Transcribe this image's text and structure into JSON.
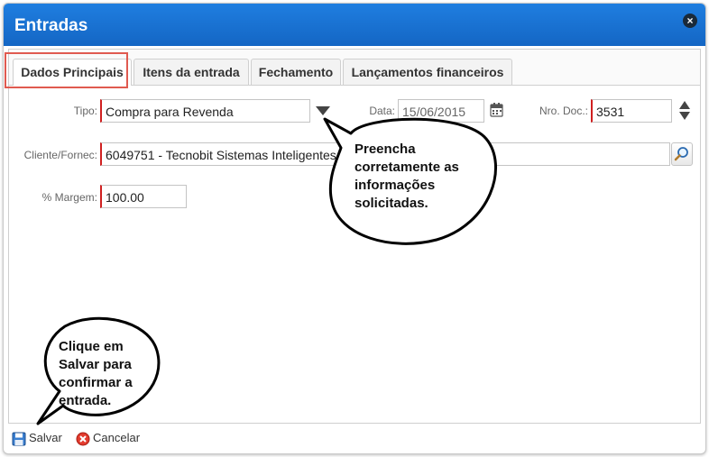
{
  "window": {
    "title": "Entradas",
    "close_glyph": "×"
  },
  "tabs": [
    {
      "label": "Dados Principais",
      "active": true
    },
    {
      "label": "Itens da entrada",
      "active": false
    },
    {
      "label": "Fechamento",
      "active": false
    },
    {
      "label": "Lançamentos financeiros",
      "active": false
    }
  ],
  "form": {
    "tipo": {
      "label": "Tipo:",
      "value": "Compra para Revenda"
    },
    "data": {
      "label": "Data:",
      "value": "15/06/2015"
    },
    "nro_doc": {
      "label": "Nro. Doc.:",
      "value": "3531"
    },
    "cliente": {
      "label": "Cliente/Fornec:",
      "value": "6049751 - Tecnobit Sistemas Inteligentes"
    },
    "margem": {
      "label": "% Margem:",
      "value": "100.00"
    }
  },
  "callouts": {
    "form_hint": [
      "Preencha",
      "corretamente as",
      "informações",
      "solicitadas."
    ],
    "save_hint": [
      "Clique em",
      "Salvar para",
      "confirmar a",
      "entrada."
    ]
  },
  "footer": {
    "save_label": "Salvar",
    "cancel_label": "Cancelar"
  },
  "colors": {
    "titlebar": "#1f7ee0",
    "required_marker": "#d02020",
    "highlight": "#e05a50"
  },
  "icons": [
    "close-icon",
    "dropdown-arrow-icon",
    "calendar-icon",
    "spinner-icon",
    "search-icon",
    "save-icon",
    "cancel-icon"
  ]
}
